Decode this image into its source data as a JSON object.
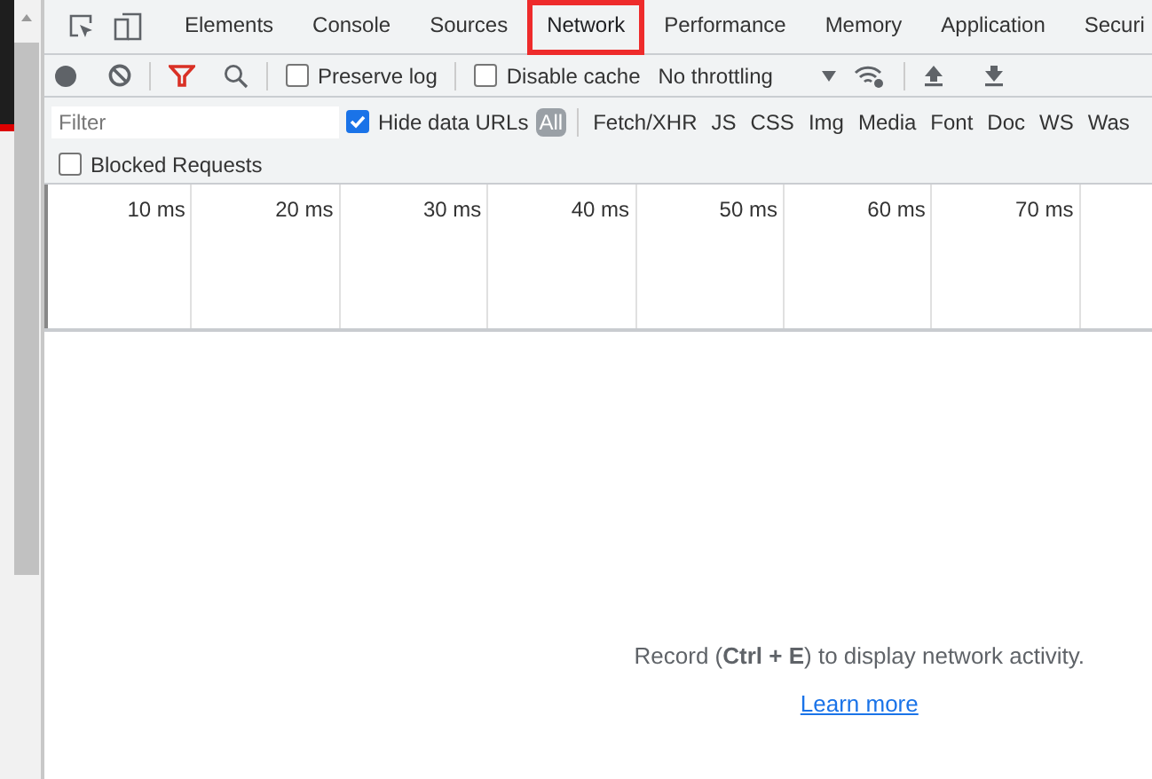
{
  "tabs": [
    {
      "label": "Elements",
      "selected": false,
      "highlighted": false
    },
    {
      "label": "Console",
      "selected": false,
      "highlighted": false
    },
    {
      "label": "Sources",
      "selected": false,
      "highlighted": false
    },
    {
      "label": "Network",
      "selected": true,
      "highlighted": true
    },
    {
      "label": "Performance",
      "selected": false,
      "highlighted": false
    },
    {
      "label": "Memory",
      "selected": false,
      "highlighted": false
    },
    {
      "label": "Application",
      "selected": false,
      "highlighted": false
    },
    {
      "label": "Securi",
      "selected": false,
      "highlighted": false
    }
  ],
  "toolbar": {
    "preserve_log": {
      "label": "Preserve log",
      "checked": false
    },
    "disable_cache": {
      "label": "Disable cache",
      "checked": false
    },
    "throttling": "No throttling"
  },
  "filter": {
    "placeholder": "Filter",
    "hide_data_urls": {
      "label": "Hide data URLs",
      "checked": true
    },
    "types": [
      {
        "label": "All",
        "selected": true
      },
      {
        "label": "Fetch/XHR",
        "selected": false
      },
      {
        "label": "JS",
        "selected": false
      },
      {
        "label": "CSS",
        "selected": false
      },
      {
        "label": "Img",
        "selected": false
      },
      {
        "label": "Media",
        "selected": false
      },
      {
        "label": "Font",
        "selected": false
      },
      {
        "label": "Doc",
        "selected": false
      },
      {
        "label": "WS",
        "selected": false
      },
      {
        "label": "Was",
        "selected": false
      }
    ],
    "blocked_requests": {
      "label": "Blocked Requests",
      "checked": false
    }
  },
  "timeline": {
    "ticks": [
      "10 ms",
      "20 ms",
      "30 ms",
      "40 ms",
      "50 ms",
      "60 ms",
      "70 ms"
    ]
  },
  "empty_state": {
    "message": "Record (**Ctrl + E**) to display network activity.",
    "link": "Learn more"
  }
}
